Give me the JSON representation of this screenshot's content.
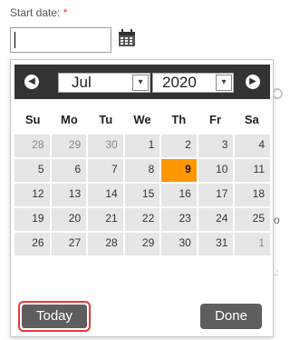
{
  "field": {
    "label": "Start date:",
    "required_mark": "*",
    "value": ""
  },
  "icons": {
    "calendar": "calendar-icon",
    "prev": "chevron-left-icon",
    "next": "chevron-right-icon",
    "dropdown": "chevron-down-icon"
  },
  "datepicker": {
    "prev_glyph": "◀",
    "next_glyph": "▶",
    "month": "Jul",
    "year": "2020",
    "dropdown_glyph": "▾",
    "weekdays": [
      "Su",
      "Mo",
      "Tu",
      "We",
      "Th",
      "Fr",
      "Sa"
    ],
    "days": [
      {
        "d": "28",
        "other": true
      },
      {
        "d": "29",
        "other": true
      },
      {
        "d": "30",
        "other": true
      },
      {
        "d": "1"
      },
      {
        "d": "2"
      },
      {
        "d": "3"
      },
      {
        "d": "4"
      },
      {
        "d": "5"
      },
      {
        "d": "6"
      },
      {
        "d": "7"
      },
      {
        "d": "8"
      },
      {
        "d": "9",
        "today": true
      },
      {
        "d": "10"
      },
      {
        "d": "11"
      },
      {
        "d": "12"
      },
      {
        "d": "13"
      },
      {
        "d": "14"
      },
      {
        "d": "15"
      },
      {
        "d": "16"
      },
      {
        "d": "17"
      },
      {
        "d": "18"
      },
      {
        "d": "19"
      },
      {
        "d": "20"
      },
      {
        "d": "21"
      },
      {
        "d": "22"
      },
      {
        "d": "23"
      },
      {
        "d": "24"
      },
      {
        "d": "25"
      },
      {
        "d": "26"
      },
      {
        "d": "27"
      },
      {
        "d": "28"
      },
      {
        "d": "29"
      },
      {
        "d": "30"
      },
      {
        "d": "31"
      },
      {
        "d": "1",
        "other": true
      }
    ],
    "today_label": "Today",
    "done_label": "Done"
  },
  "colors": {
    "header_bg": "#333333",
    "today_highlight": "#ff9800",
    "button_bg": "#5e5e5e",
    "focus_ring": "#e53935",
    "required": "#e53935"
  },
  "background_fragments": {
    "o": "o",
    "dots": ".:"
  }
}
